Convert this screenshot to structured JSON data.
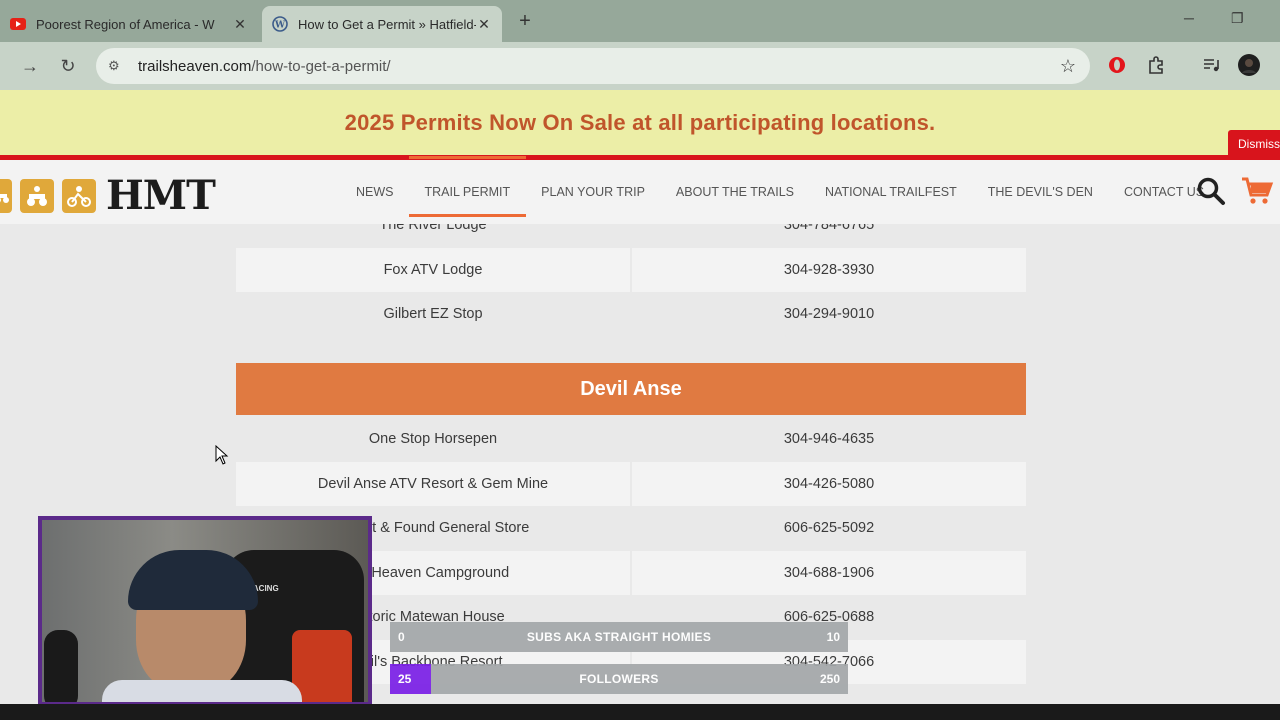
{
  "browser": {
    "tabs": [
      {
        "title": "Poorest Region of America - W",
        "icon": "youtube-icon",
        "active": false
      },
      {
        "title": "How to Get a Permit » Hatfield-",
        "icon": "wordpress-icon",
        "active": true
      }
    ],
    "new_tab": "+",
    "address": {
      "domain": "trailsheaven.com",
      "path": "/how-to-get-a-permit/"
    }
  },
  "site": {
    "banner": "2025 Permits Now On Sale at all participating locations.",
    "dismiss": "Dismiss",
    "logo_text": "HMT",
    "nav": [
      "NEWS",
      "TRAIL PERMIT",
      "PLAN YOUR TRIP",
      "ABOUT THE TRAILS",
      "NATIONAL TRAILFEST",
      "THE DEVIL'S DEN",
      "CONTACT US"
    ],
    "nav_active": "TRAIL PERMIT",
    "accent": "#ed6a35"
  },
  "table": {
    "top_rows": [
      {
        "name": "The River Lodge",
        "phone": "304-784-6765"
      },
      {
        "name": "Fox ATV Lodge",
        "phone": "304-928-3930"
      },
      {
        "name": "Gilbert EZ Stop",
        "phone": "304-294-9010"
      }
    ],
    "section": "Devil Anse",
    "section_rows": [
      {
        "name": "One Stop Horsepen",
        "phone": "304-946-4635"
      },
      {
        "name": "Devil Anse ATV Resort & Gem Mine",
        "phone": "304-426-5080"
      },
      {
        "name": "n Lost & Found General Store",
        "phone": "606-625-5092"
      },
      {
        "name": "ly Heaven Campground",
        "phone": "304-688-1906"
      },
      {
        "name": "storic Matewan House",
        "phone": "606-625-0688"
      },
      {
        "name": "vil's Backbone Resort",
        "phone": "304-542-7066"
      }
    ]
  },
  "overlay": {
    "subs_bar": {
      "min": "0",
      "label": "SUBS AKA STRAIGHT HOMIES",
      "max": "10",
      "progress": 0.0
    },
    "followers_bar": {
      "min": "25",
      "label": "FOLLOWERS",
      "max": "250",
      "progress": 0.09
    },
    "webcam_logo": "GTRACING"
  }
}
